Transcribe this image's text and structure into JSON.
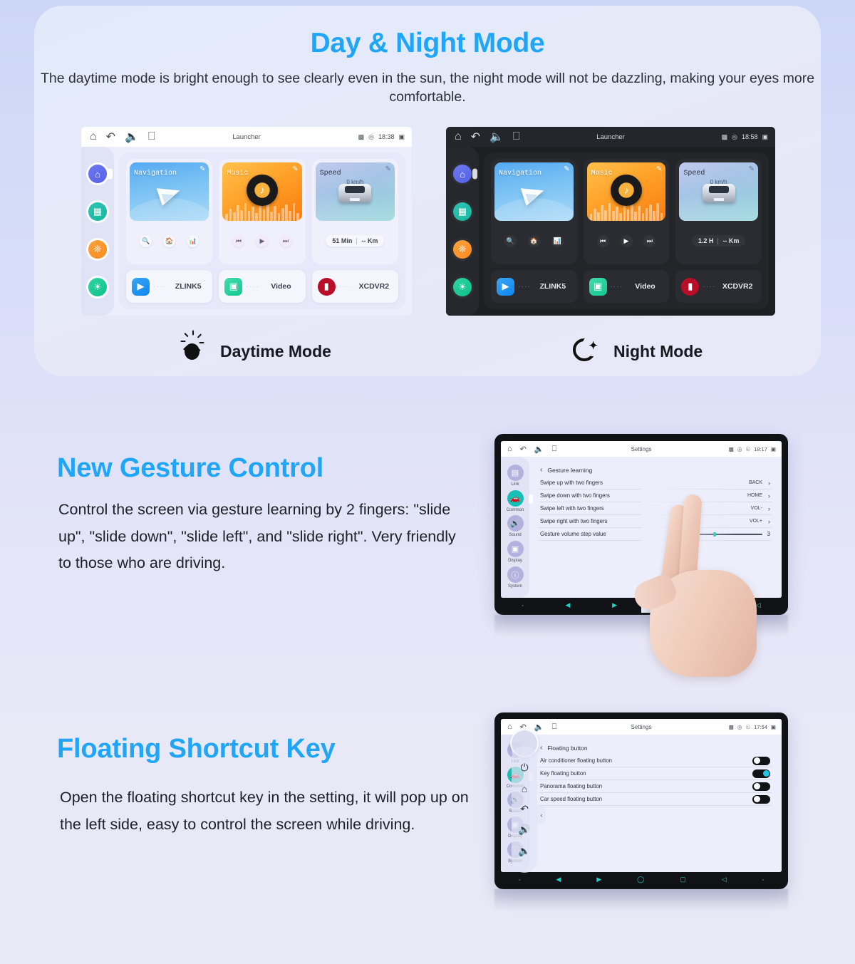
{
  "sections": {
    "day_night": {
      "title": "Day & Night Mode",
      "subtitle": "The daytime mode is bright enough to see clearly even in the sun, the night mode will not be dazzling, making your eyes more comfortable.",
      "accent_color": "#1FA6F8",
      "caption_day": "Daytime Mode",
      "caption_night": "Night Mode"
    },
    "gesture": {
      "title": "New Gesture Control",
      "body": "Control the screen via gesture learning by 2 fingers: \"slide up\", \"slide down\", \"slide left\", and \"slide right\". Very friendly to those who are driving.",
      "accent_color": "#1FA6F8"
    },
    "floating": {
      "title": "Floating Shortcut Key",
      "body": "Open the floating shortcut key in the setting, it will pop up on the left side, easy to control the screen while driving.",
      "accent_color": "#1FA6F8"
    }
  },
  "launcher_day": {
    "status": {
      "title": "Launcher",
      "time": "18:38"
    },
    "rail": [
      {
        "name": "home",
        "label": "Home"
      },
      {
        "name": "apps",
        "label": "Apps"
      },
      {
        "name": "settings",
        "label": "Settings"
      },
      {
        "name": "brightness",
        "label": "Brightness"
      }
    ],
    "widgets": [
      {
        "label": "Navigation",
        "type": "nav"
      },
      {
        "label": "Music",
        "type": "music"
      },
      {
        "label": "Speed",
        "type": "speed",
        "speed_value": "0 km/h",
        "trip_time": "51 Min",
        "trip_dist": "-- Km"
      }
    ],
    "apps": [
      {
        "name": "ZLINK5",
        "icon": "play-circle-icon"
      },
      {
        "name": "Video",
        "icon": "video-card-icon"
      },
      {
        "name": "XCDVR2",
        "icon": "camcorder-icon"
      }
    ]
  },
  "launcher_night": {
    "status": {
      "title": "Launcher",
      "time": "18:58"
    },
    "widgets": [
      {
        "label": "Navigation",
        "type": "nav"
      },
      {
        "label": "Music",
        "type": "music"
      },
      {
        "label": "Speed",
        "type": "speed",
        "speed_value": "0 km/h",
        "trip_time": "1.2 H",
        "trip_dist": "-- Km"
      }
    ],
    "apps": [
      {
        "name": "ZLINK5",
        "icon": "play-circle-icon"
      },
      {
        "name": "Video",
        "icon": "video-card-icon"
      },
      {
        "name": "XCDVR2",
        "icon": "camcorder-icon"
      }
    ]
  },
  "settings_gesture": {
    "status": {
      "title": "Settings",
      "time": "18:17"
    },
    "rail": [
      {
        "label": "Link",
        "icon": "screen-link-icon",
        "active": false
      },
      {
        "label": "Common",
        "icon": "car-icon",
        "active": true
      },
      {
        "label": "Sound",
        "icon": "speaker-icon",
        "active": false
      },
      {
        "label": "Display",
        "icon": "display-icon",
        "active": false
      },
      {
        "label": "System",
        "icon": "info-icon",
        "active": false
      }
    ],
    "breadcrumb": "Gesture learning",
    "rows": [
      {
        "label": "Swipe up with two fingers",
        "value": "BACK"
      },
      {
        "label": "Swipe down with two fingers",
        "value": "HOME"
      },
      {
        "label": "Swipe left with two fingers",
        "value": "VOL-"
      },
      {
        "label": "Swipe right with two fingers",
        "value": "VOL+"
      }
    ],
    "slider_row": {
      "label": "Gesture volume step value",
      "value": "3"
    }
  },
  "settings_floating": {
    "status": {
      "title": "Settings",
      "time": "17:54"
    },
    "rail": [
      {
        "label": "Link",
        "icon": "screen-link-icon",
        "active": false
      },
      {
        "label": "Common",
        "icon": "car-icon",
        "active": true
      },
      {
        "label": "Sound",
        "icon": "speaker-icon",
        "active": false
      },
      {
        "label": "Display",
        "icon": "display-icon",
        "active": false
      },
      {
        "label": "System",
        "icon": "info-icon",
        "active": false
      }
    ],
    "breadcrumb": "Floating button",
    "rows": [
      {
        "label": "Air conditioner floating button",
        "on": false
      },
      {
        "label": "Key floating button",
        "on": true
      },
      {
        "label": "Panorama floating button",
        "on": false
      },
      {
        "label": "Car speed floating button",
        "on": false
      }
    ],
    "floating_bar": [
      {
        "icon": "power-icon"
      },
      {
        "icon": "home-icon"
      },
      {
        "icon": "back-icon"
      },
      {
        "icon": "volume-up-icon"
      },
      {
        "icon": "volume-down-icon"
      }
    ]
  }
}
